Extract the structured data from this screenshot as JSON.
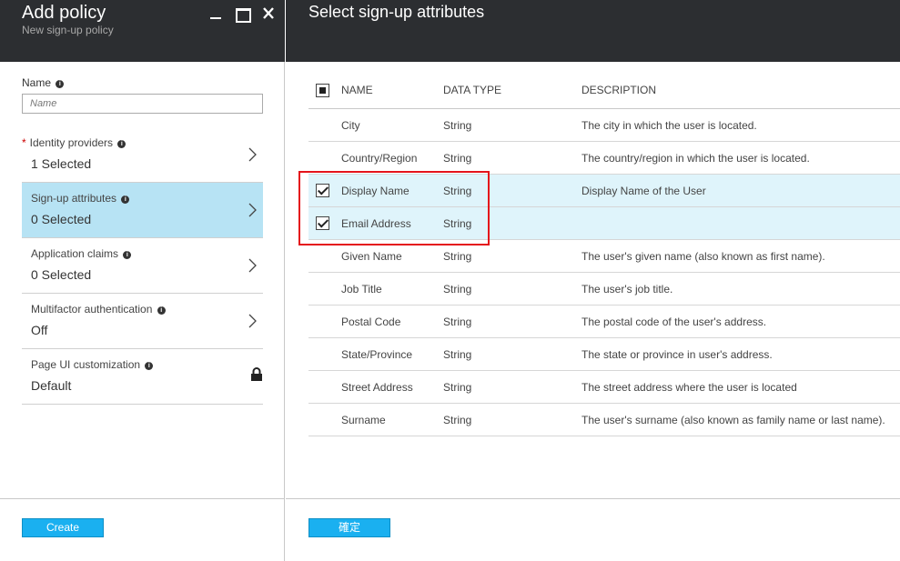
{
  "left_blade": {
    "title": "Add policy",
    "subtitle": "New sign-up policy",
    "name_field": {
      "label": "Name",
      "placeholder": "Name",
      "value": ""
    },
    "items": [
      {
        "label": "Identity providers",
        "value": "1 Selected",
        "required": true,
        "selected": false,
        "action": "chevron"
      },
      {
        "label": "Sign-up attributes",
        "value": "0 Selected",
        "required": false,
        "selected": true,
        "action": "chevron"
      },
      {
        "label": "Application claims",
        "value": "0 Selected",
        "required": false,
        "selected": false,
        "action": "chevron"
      },
      {
        "label": "Multifactor authentication",
        "value": "Off",
        "required": false,
        "selected": false,
        "action": "chevron"
      },
      {
        "label": "Page UI customization",
        "value": "Default",
        "required": false,
        "selected": false,
        "action": "lock"
      }
    ],
    "required_marker": "*",
    "info_glyph": "i",
    "create_label": "Create"
  },
  "right_blade": {
    "title": "Select sign-up attributes",
    "columns": {
      "name": "NAME",
      "type": "DATA TYPE",
      "description": "DESCRIPTION"
    },
    "rows": [
      {
        "name": "City",
        "type": "String",
        "description": "The city in which the user is located.",
        "checked": false
      },
      {
        "name": "Country/Region",
        "type": "String",
        "description": "The country/region in which the user is located.",
        "checked": false
      },
      {
        "name": "Display Name",
        "type": "String",
        "description": "Display Name of the User",
        "checked": true
      },
      {
        "name": "Email Address",
        "type": "String",
        "description": "",
        "checked": true
      },
      {
        "name": "Given Name",
        "type": "String",
        "description": "The user's given name (also known as first name).",
        "checked": false
      },
      {
        "name": "Job Title",
        "type": "String",
        "description": "The user's job title.",
        "checked": false
      },
      {
        "name": "Postal Code",
        "type": "String",
        "description": "The postal code of the user's address.",
        "checked": false
      },
      {
        "name": "State/Province",
        "type": "String",
        "description": "The state or province in user's address.",
        "checked": false
      },
      {
        "name": "Street Address",
        "type": "String",
        "description": "The street address where the user is located",
        "checked": false
      },
      {
        "name": "Surname",
        "type": "String",
        "description": "The user's surname (also known as family name or last name).",
        "checked": false
      }
    ],
    "ok_label": "確定"
  },
  "colors": {
    "header_bg": "#2c2e31",
    "selected_bg": "#b7e3f4",
    "checked_row_bg": "#dff4fb",
    "button_bg": "#1ab0f0",
    "highlight": "#e4141b",
    "required": "#cc0000"
  },
  "icons": {
    "minimize": "minimize-icon",
    "maximize": "maximize-icon",
    "close": "close-icon",
    "chevron": "chevron-right-icon",
    "lock": "lock-icon",
    "info": "info-icon",
    "checkbox": "checkbox-icon"
  }
}
